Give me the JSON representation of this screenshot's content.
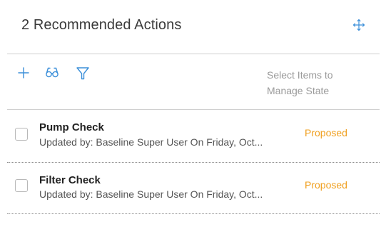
{
  "header": {
    "title": "2 Recommended Actions"
  },
  "toolbar": {
    "hint": "Select Items to Manage State"
  },
  "items": [
    {
      "title": "Pump Check",
      "subtitle": "Updated by: Baseline Super User On  Friday, Oct...",
      "status": "Proposed"
    },
    {
      "title": "Filter Check",
      "subtitle": "Updated by: Baseline Super User On  Friday, Oct...",
      "status": "Proposed"
    }
  ],
  "colors": {
    "accent": "#3b8fd9",
    "status_proposed": "#f0a020"
  },
  "icons": {
    "move": "move-arrows-icon",
    "add": "plus-icon",
    "search": "binoculars-icon",
    "filter": "filter-icon"
  }
}
